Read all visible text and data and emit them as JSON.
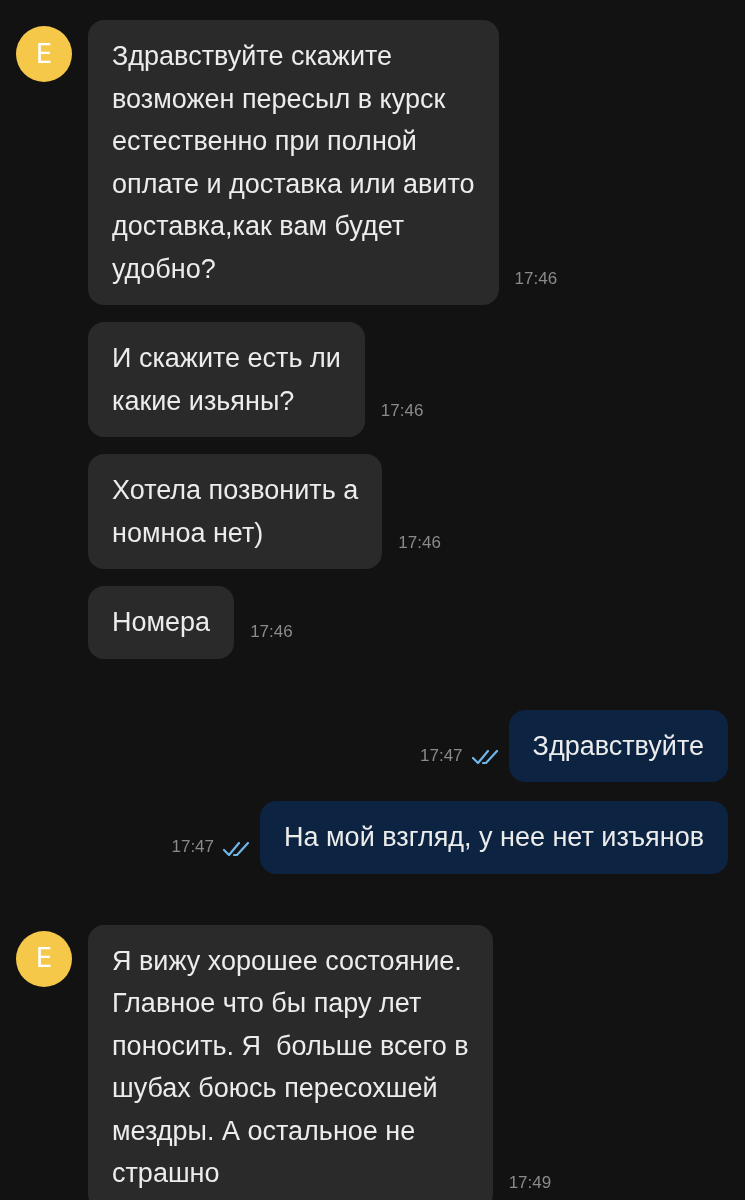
{
  "groups": [
    {
      "kind": "incoming",
      "avatar": "E",
      "messages": [
        {
          "text": "Здравствуйте скажите\nвозможен пересыл в курск\nестественно при полной\nоплате и доставка или авито\nдоставка,как вам будет\nудобно?",
          "time": "17:46"
        },
        {
          "text": "И скажите есть ли\nкакие изьяны?",
          "time": "17:46"
        },
        {
          "text": "Хотела позвонить а\nномноа нет)",
          "time": "17:46"
        },
        {
          "text": "Номера",
          "time": "17:46"
        }
      ]
    },
    {
      "kind": "outgoing",
      "messages": [
        {
          "text": "Здравствуйте",
          "time": "17:47",
          "read": true
        },
        {
          "text": "На мой взгляд, у нее нет изъянов",
          "time": "17:47",
          "read": true
        }
      ]
    },
    {
      "kind": "incoming",
      "avatar": "E",
      "messages": [
        {
          "text": "Я вижу хорошее состояние.\nГлавное что бы пару лет\nпоносить. Я  больше всего в\nшубах боюсь пересохшей\nмездры. А остальное не\nстрашно",
          "time": "17:49"
        }
      ]
    }
  ]
}
